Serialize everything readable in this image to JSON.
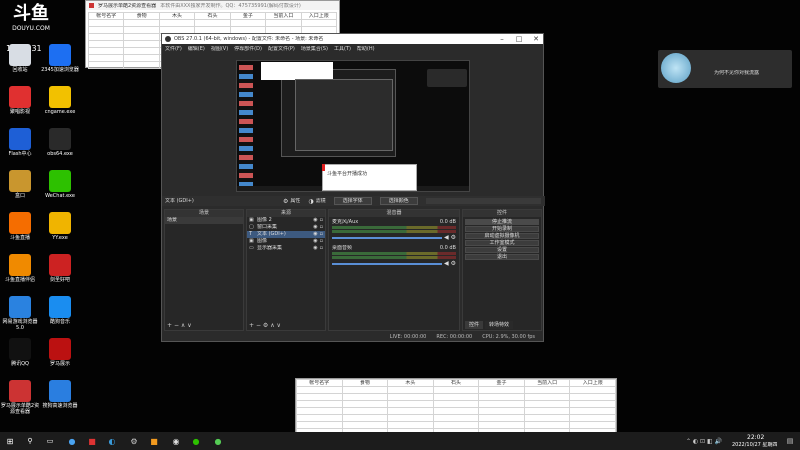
{
  "desktop_left": [
    {
      "label": "回收站",
      "icon": "recycle-bin-icon",
      "color": "#d8dde4"
    },
    {
      "label": "2345加速浏览器",
      "icon": "browser-2345-icon",
      "color": "#1d6ff2"
    },
    {
      "label": "聚唱影视",
      "icon": "media-app-icon",
      "color": "#e03030"
    },
    {
      "label": "cngame.exe",
      "icon": "pacman-icon",
      "color": "#f2c100"
    },
    {
      "label": "Flash中心",
      "icon": "flash-icon",
      "color": "#1e5fd6"
    },
    {
      "label": "obs64.exe",
      "icon": "obs-icon",
      "color": "#2a2a2a"
    },
    {
      "label": "盒口",
      "icon": "box-icon",
      "color": "#c9962e"
    },
    {
      "label": "WeChat.exe",
      "icon": "wechat-icon",
      "color": "#2dc100"
    },
    {
      "label": "斗鱼直播",
      "icon": "douyu-icon",
      "color": "#f56d00"
    },
    {
      "label": "YY.exe",
      "icon": "yy-icon",
      "color": "#f0b400"
    },
    {
      "label": "斗鱼直播伴侣",
      "icon": "douyu-companion-icon",
      "color": "#f08a00"
    },
    {
      "label": "剑圣好吧",
      "icon": "game-helmet-icon",
      "color": "#c22"
    },
    {
      "label": "网易游戏浏览器5.0",
      "icon": "netease-browser-icon",
      "color": "#2a82e0"
    },
    {
      "label": "酷狗音乐",
      "icon": "kugou-icon",
      "color": "#1a8df0"
    },
    {
      "label": "腾讯QQ",
      "icon": "qq-icon",
      "color": "#111"
    },
    {
      "label": "罗马展示",
      "icon": "helmet-icon",
      "color": "#b11"
    },
    {
      "label": "罗马展示单酷2资源查看器",
      "icon": "viewer-icon",
      "color": "#c33"
    },
    {
      "label": "搜狗高速浏览器",
      "icon": "sogou-browser-icon",
      "color": "#2a7ee0"
    }
  ],
  "douyu": {
    "logo": "斗鱼",
    "domain": "DOUYU.COM",
    "room": "1002931"
  },
  "excel_top": {
    "title": "罗马展示单酷2资源查看器",
    "note": "本软件由XXX独家开发制作。QQ：475735991(解码付款设计)",
    "headers": [
      "帐号名字",
      "食物",
      "木头",
      "石头",
      "金子",
      "当前入口",
      "入口上限"
    ]
  },
  "excel_bottom": {
    "headers": [
      "帐号名字",
      "食物",
      "木头",
      "石头",
      "金子",
      "当前入口",
      "入口上限"
    ]
  },
  "obs": {
    "title": "OBS 27.0.1 (64-bit, windows) - 配置文件: 未命名 - 场景: 未命名",
    "menu": [
      "文件(F)",
      "编辑(E)",
      "视图(V)",
      "停靠部件(D)",
      "配置文件(P)",
      "场景集合(S)",
      "工具(T)",
      "帮助(H)"
    ],
    "preview_toast": "斗鱼平台开播成功",
    "source_label": "文本 (GDI+)",
    "prop_btn": "属性",
    "filter_btn": "滤镜",
    "choose_font": "选择字体",
    "choose_color": "选择颜色",
    "docks": {
      "scenes": "场景",
      "sources": "来源",
      "mixer": "混音器",
      "controls": "控件"
    },
    "scene_items": [
      "场景"
    ],
    "source_items": [
      {
        "label": "图像 2",
        "icon": "image-icon"
      },
      {
        "label": "窗口采集",
        "icon": "window-icon"
      },
      {
        "label": "文本 (GDI+)",
        "icon": "text-icon"
      },
      {
        "label": "图像",
        "icon": "image-icon"
      },
      {
        "label": "显示器采集",
        "icon": "monitor-icon"
      }
    ],
    "mixer_tracks": [
      {
        "name": "麦克风/Aux",
        "db": "0.0 dB"
      },
      {
        "name": "桌面音频",
        "db": "0.0 dB"
      }
    ],
    "controls": [
      "停止推流",
      "开始录制",
      "启动虚拟摄像机",
      "工作室模式",
      "设置",
      "退出"
    ],
    "tabs": [
      "控件",
      "转场特效"
    ],
    "status": {
      "live": "LIVE: 00:00:00",
      "rec": "REC: 00:00:00",
      "cpu": "CPU: 2.9%, 30.00 fps"
    }
  },
  "notification": {
    "text": "为何不见你对我流露"
  },
  "taskbar": {
    "time": "22:02",
    "date": "2022/10/27 星期四"
  }
}
